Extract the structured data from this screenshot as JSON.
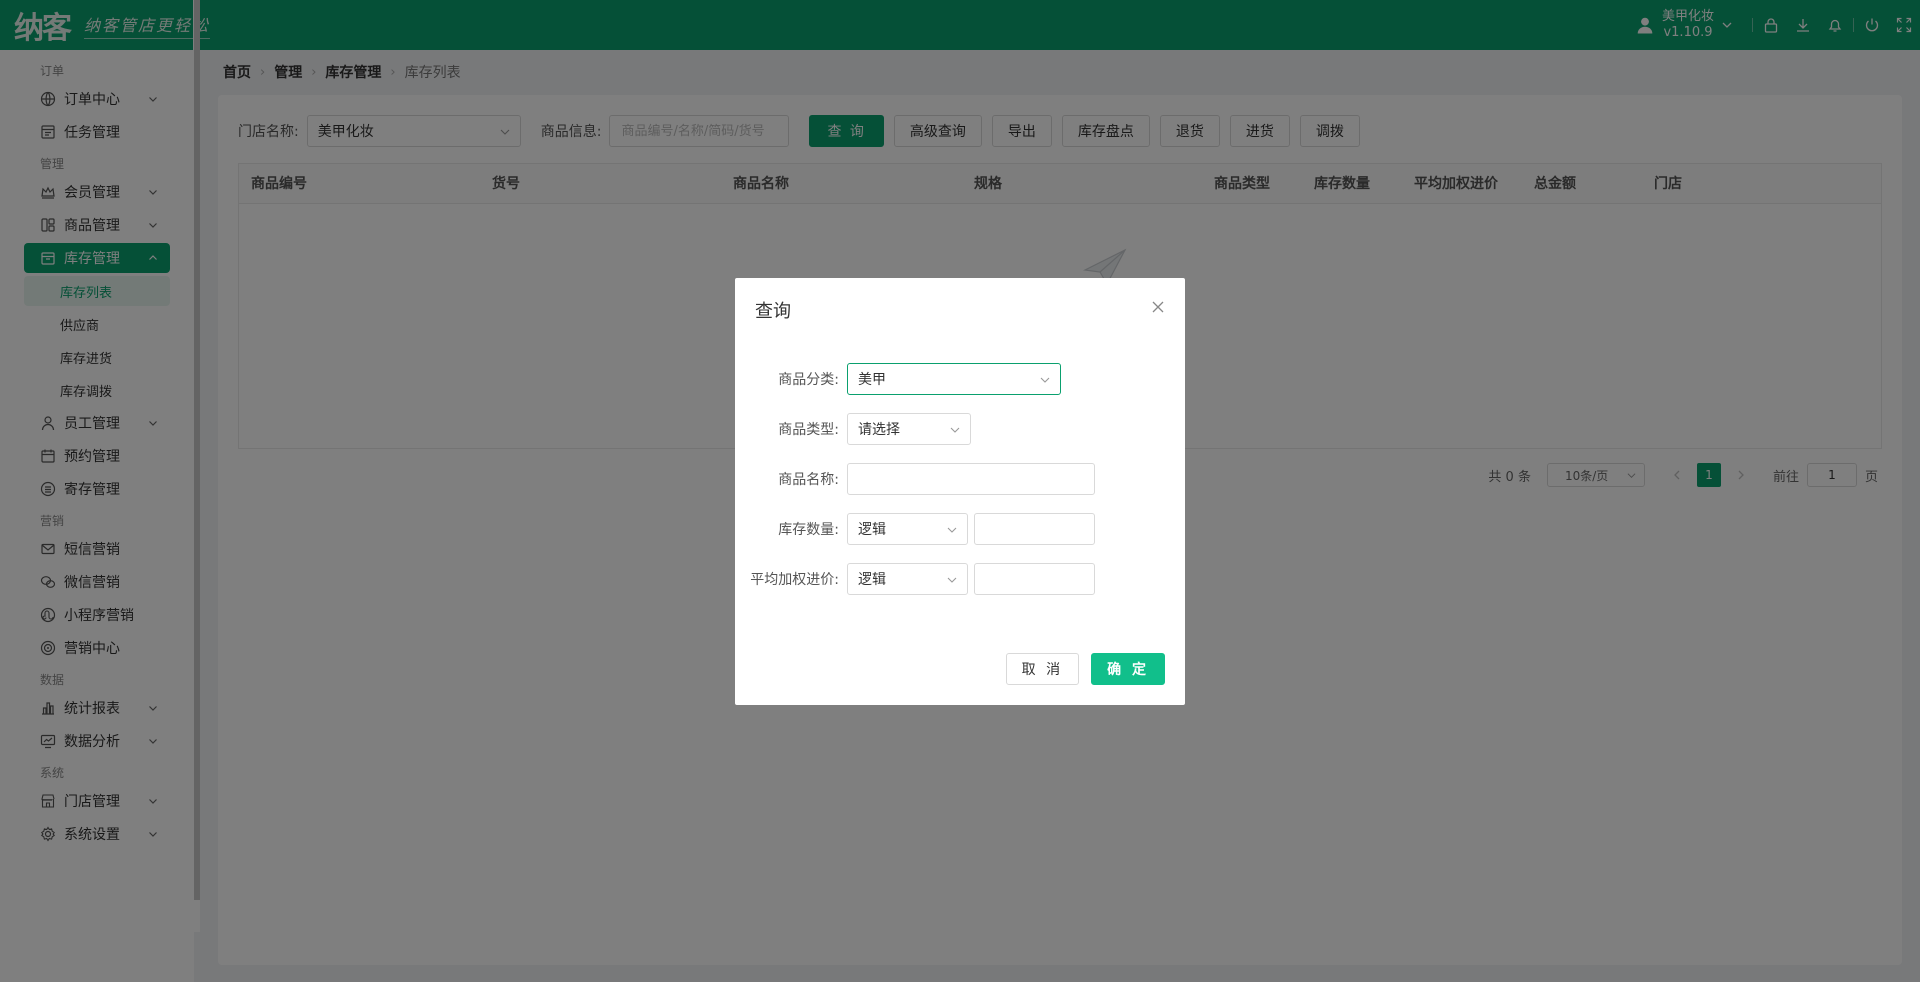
{
  "header": {
    "logo_text": "纳客",
    "slogan": "纳客管店更轻松",
    "user_name": "美甲化妆",
    "version": "v1.10.9",
    "icons": [
      "user-icon",
      "lock-icon",
      "download-icon",
      "bell-icon",
      "power-icon",
      "fullscreen-icon"
    ]
  },
  "sidebar": {
    "sections": {
      "order": "订单",
      "manage": "管理",
      "marketing": "营销",
      "data": "数据",
      "system": "系统"
    },
    "items": {
      "order_center": "订单中心",
      "task_manage": "任务管理",
      "member_manage": "会员管理",
      "goods_manage": "商品管理",
      "inventory_manage": "库存管理",
      "inventory_list": "库存列表",
      "supplier": "供应商",
      "inventory_purchase": "库存进货",
      "inventory_transfer": "库存调拨",
      "staff_manage": "员工管理",
      "booking_manage": "预约管理",
      "deposit_manage": "寄存管理",
      "sms_marketing": "短信营销",
      "wechat_marketing": "微信营销",
      "miniprogram_marketing": "小程序营销",
      "marketing_center": "营销中心",
      "stats_report": "统计报表",
      "data_analysis": "数据分析",
      "store_manage": "门店管理",
      "system_settings": "系统设置"
    }
  },
  "breadcrumb": [
    "首页",
    "管理",
    "库存管理",
    "库存列表"
  ],
  "filters": {
    "store_label": "门店名称:",
    "store_value": "美甲化妆",
    "goods_label": "商品信息:",
    "goods_placeholder": "商品编号/名称/简码/货号",
    "buttons": {
      "query": "查 询",
      "advanced": "高级查询",
      "export": "导出",
      "stocktake": "库存盘点",
      "return": "退货",
      "purchase": "进货",
      "transfer": "调拨"
    }
  },
  "table": {
    "columns": [
      "商品编号",
      "货号",
      "商品名称",
      "规格",
      "商品类型",
      "库存数量",
      "平均加权进价",
      "总金额",
      "门店"
    ]
  },
  "pager": {
    "total": "共 0 条",
    "page_size": "10条/页",
    "current_page": "1",
    "goto_label": "前往",
    "goto_value": "1",
    "page_unit": "页"
  },
  "modal": {
    "title": "查询",
    "category_label": "商品分类:",
    "category_value": "美甲",
    "type_label": "商品类型:",
    "type_value": "请选择",
    "name_label": "商品名称:",
    "name_value": "",
    "stock_label": "库存数量:",
    "stock_logic": "逻辑",
    "stock_value": "",
    "avgprice_label": "平均加权进价:",
    "avgprice_logic": "逻辑",
    "avgprice_value": "",
    "cancel": "取 消",
    "confirm": "确 定"
  },
  "colors": {
    "brand": "#0aa06e",
    "confirm": "#11bf8b"
  }
}
